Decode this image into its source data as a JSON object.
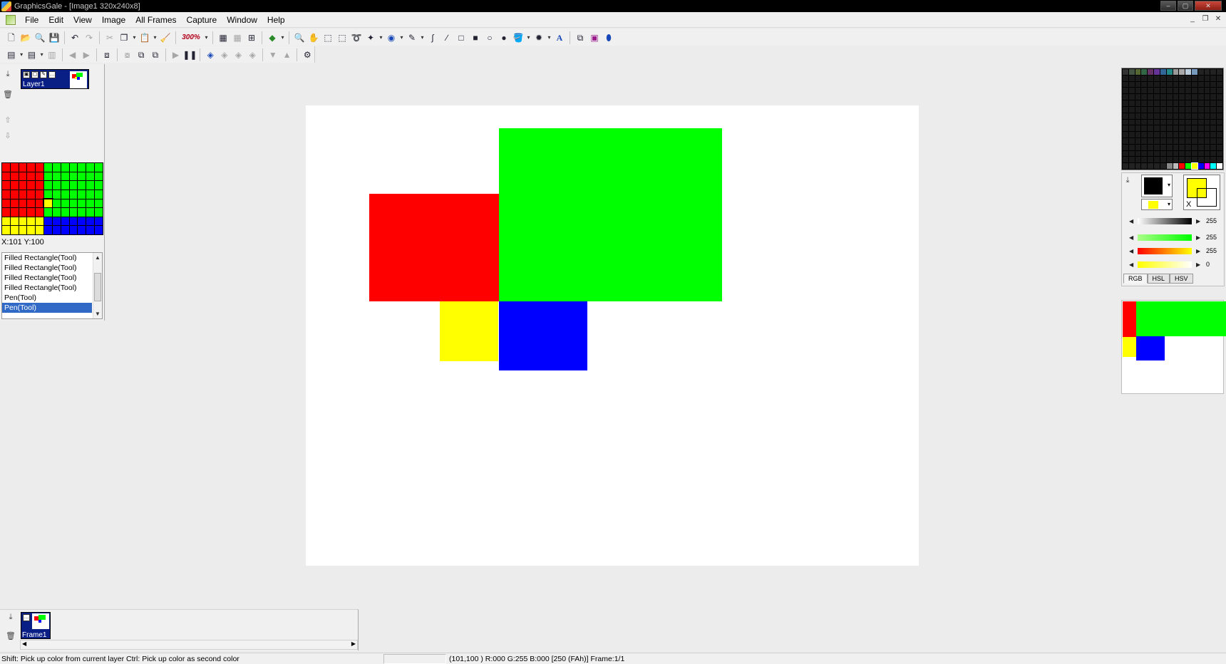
{
  "window": {
    "title": "GraphicsGale - [Image1 320x240x8]",
    "controls": [
      "–",
      "▢",
      "✕"
    ]
  },
  "menu": [
    "File",
    "Edit",
    "View",
    "Image",
    "All Frames",
    "Capture",
    "Window",
    "Help"
  ],
  "mdi_controls": [
    "_",
    "❐",
    "✕"
  ],
  "toolbar": {
    "zoom_label": "300%"
  },
  "layers": {
    "name": "Layer1"
  },
  "coords_readout": "X:101 Y:100",
  "history": [
    "Filled Rectangle(Tool)",
    "Filled Rectangle(Tool)",
    "Filled Rectangle(Tool)",
    "Filled Rectangle(Tool)",
    "Pen(Tool)",
    "Pen(Tool)"
  ],
  "colors": {
    "red": "#ff0000",
    "green": "#00ff00",
    "yellow": "#ffff00",
    "blue": "#0000ff",
    "black": "#000000",
    "selection": "#3169c6"
  },
  "color_panel": {
    "slider_values": [
      "255",
      "255",
      "255",
      "0"
    ],
    "tabs": [
      "RGB",
      "HSL",
      "HSV"
    ],
    "second_color_mark": "X"
  },
  "frames": {
    "name": "Frame1"
  },
  "status": {
    "left": "Shift: Pick up color from current layer  Ctrl: Pick up color as second color",
    "right": "(101,100 ) R:000 G:255 B:000  [250 (FAh)]  Frame:1/1"
  }
}
